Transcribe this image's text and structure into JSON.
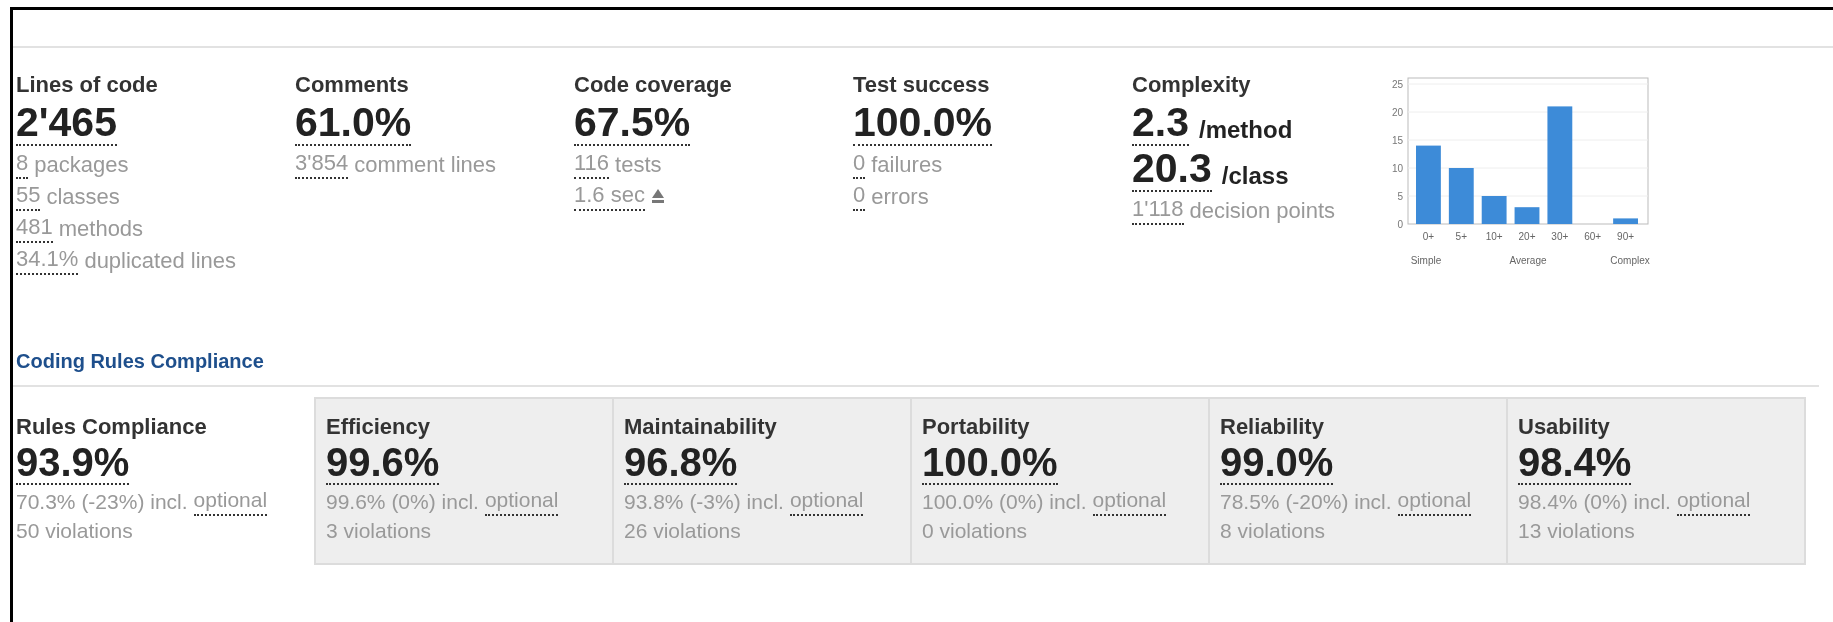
{
  "metrics": [
    {
      "title": "Lines of code",
      "values": [
        {
          "value": "2'465"
        }
      ],
      "lines": [
        {
          "link": "8",
          "text": "packages"
        },
        {
          "link": "55",
          "text": "classes"
        },
        {
          "link": "481",
          "text": "methods"
        },
        {
          "link": "34.1%",
          "text": "duplicated lines"
        }
      ]
    },
    {
      "title": "Comments",
      "values": [
        {
          "value": "61.0%"
        }
      ],
      "lines": [
        {
          "link": "3'854",
          "text": "comment lines"
        }
      ]
    },
    {
      "title": "Code coverage",
      "values": [
        {
          "value": "67.5%"
        }
      ],
      "lines": [
        {
          "link": "116",
          "text": "tests"
        },
        {
          "link": "1.6 sec",
          "trend_icon": true
        }
      ]
    },
    {
      "title": "Test success",
      "values": [
        {
          "value": "100.0%"
        }
      ],
      "lines": [
        {
          "link": "0",
          "text": "failures"
        },
        {
          "link": "0",
          "text": "errors"
        }
      ]
    },
    {
      "title": "Complexity",
      "values": [
        {
          "value": "2.3",
          "unit": "/method"
        },
        {
          "value": "20.3",
          "unit": "/class"
        }
      ],
      "lines": [
        {
          "link": "1'118",
          "text": "decision points"
        }
      ],
      "chart_data": {
        "type": "bar",
        "categories": [
          "0+",
          "5+",
          "10+",
          "20+",
          "30+",
          "60+",
          "90+"
        ],
        "values": [
          14,
          10,
          5,
          3,
          21,
          0,
          1
        ],
        "ylim": [
          0,
          25
        ],
        "yticks": [
          0,
          5,
          10,
          15,
          20,
          25
        ],
        "grid": true,
        "annotations": [
          "Simple",
          "Average",
          "Complex"
        ]
      }
    }
  ],
  "rules": {
    "heading": "Coding Rules Compliance",
    "items": [
      {
        "kind": "summary",
        "title": "Rules Compliance",
        "value": "93.9%",
        "detail": "70.3% (-23%) incl.",
        "link": "optional",
        "violations": "50 violations"
      },
      {
        "kind": "characteristic",
        "title": "Efficiency",
        "value": "99.6%",
        "detail": "99.6% (0%) incl.",
        "link": "optional",
        "violations": "3 violations"
      },
      {
        "kind": "characteristic",
        "title": "Maintainability",
        "value": "96.8%",
        "detail": "93.8% (-3%) incl.",
        "link": "optional",
        "violations": "26 violations"
      },
      {
        "kind": "characteristic",
        "title": "Portability",
        "value": "100.0%",
        "detail": "100.0% (0%) incl.",
        "link": "optional",
        "violations": "0 violations"
      },
      {
        "kind": "characteristic",
        "title": "Reliability",
        "value": "99.0%",
        "detail": "78.5% (-20%) incl.",
        "link": "optional",
        "violations": "8 violations"
      },
      {
        "kind": "characteristic",
        "title": "Usability",
        "value": "98.4%",
        "detail": "98.4% (0%) incl.",
        "link": "optional",
        "violations": "13 violations"
      }
    ]
  }
}
